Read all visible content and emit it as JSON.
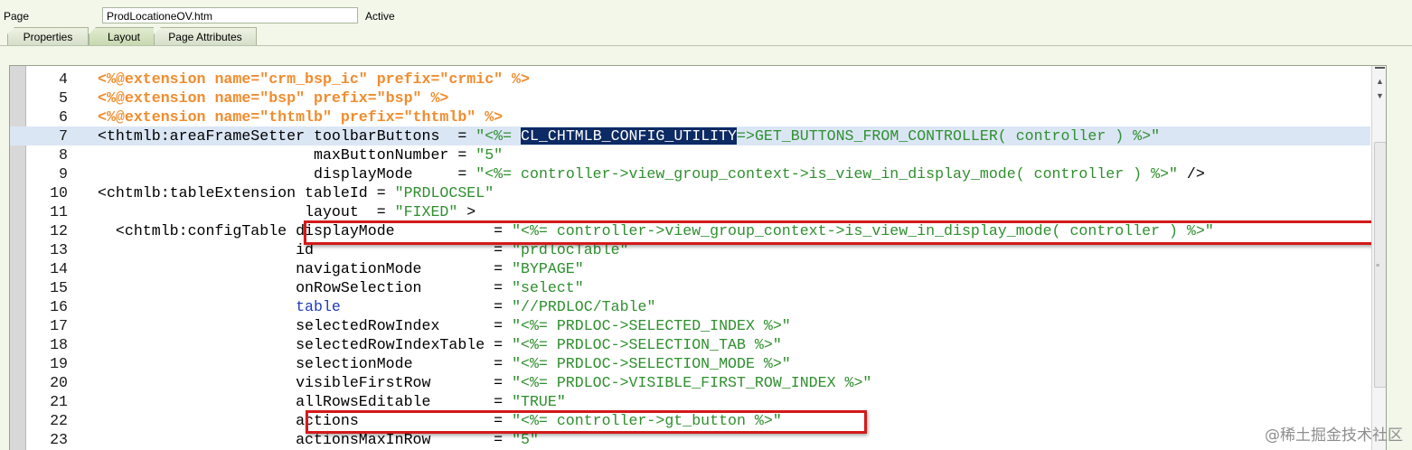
{
  "header": {
    "page_label": "Page",
    "page_value": "ProdLocationeOV.htm",
    "status": "Active"
  },
  "tabs": [
    {
      "label": "Properties",
      "active": false
    },
    {
      "label": "Layout",
      "active": true
    },
    {
      "label": "Page Attributes",
      "active": false
    }
  ],
  "editor": {
    "lines": [
      {
        "num": "4",
        "parts": [
          {
            "t": "<%@extension name=\"crm_bsp_ic\" prefix=\"crmic\" %>",
            "c": "dir"
          }
        ]
      },
      {
        "num": "5",
        "parts": [
          {
            "t": "<%@extension name=\"bsp\" prefix=\"bsp\" %>",
            "c": "dir"
          }
        ]
      },
      {
        "num": "6",
        "parts": [
          {
            "t": "<%@extension name=\"thtmlb\" prefix=\"thtmlb\" %>",
            "c": "dir"
          }
        ]
      },
      {
        "num": "7",
        "highlight": true,
        "parts": [
          {
            "t": "<thtmlb:areaFrameSetter toolbarButtons  = ",
            "c": ""
          },
          {
            "t": "\"<%= ",
            "c": "str"
          },
          {
            "t": "CL_CHTMLB_CONFIG_UTILITY",
            "c": "sel"
          },
          {
            "t": "=>GET_BUTTONS_FROM_CONTROLLER( controller ) %>\"",
            "c": "str"
          }
        ]
      },
      {
        "num": "8",
        "parts": [
          {
            "t": "                        maxButtonNumber = ",
            "c": ""
          },
          {
            "t": "\"5\"",
            "c": "str"
          }
        ]
      },
      {
        "num": "9",
        "parts": [
          {
            "t": "                        displayMode     = ",
            "c": ""
          },
          {
            "t": "\"<%= controller->view_group_context->is_view_in_display_mode( controller ) %>\"",
            "c": "str"
          },
          {
            "t": " />",
            "c": ""
          }
        ]
      },
      {
        "num": "10",
        "parts": [
          {
            "t": "<chtmlb:tableExtension tableId = ",
            "c": ""
          },
          {
            "t": "\"PRDLOCSEL\"",
            "c": "str"
          }
        ]
      },
      {
        "num": "11",
        "parts": [
          {
            "t": "                       layout  = ",
            "c": ""
          },
          {
            "t": "\"FIXED\"",
            "c": "str"
          },
          {
            "t": " >",
            "c": ""
          }
        ]
      },
      {
        "num": "12",
        "parts": [
          {
            "t": "  <chtmlb:configTable displayMode           = ",
            "c": ""
          },
          {
            "t": "\"<%= controller->view_group_context->is_view_in_display_mode( controller ) %>\"",
            "c": "str"
          }
        ]
      },
      {
        "num": "13",
        "parts": [
          {
            "t": "                      id                    = ",
            "c": ""
          },
          {
            "t": "\"prdlocTable\"",
            "c": "str"
          }
        ]
      },
      {
        "num": "14",
        "parts": [
          {
            "t": "                      navigationMode        = ",
            "c": ""
          },
          {
            "t": "\"BYPAGE\"",
            "c": "str"
          }
        ]
      },
      {
        "num": "15",
        "parts": [
          {
            "t": "                      onRowSelection        = ",
            "c": ""
          },
          {
            "t": "\"select\"",
            "c": "str"
          }
        ]
      },
      {
        "num": "16",
        "parts": [
          {
            "t": "                      ",
            "c": ""
          },
          {
            "t": "table",
            "c": "kw"
          },
          {
            "t": "                 = ",
            "c": ""
          },
          {
            "t": "\"//PRDLOC/Table\"",
            "c": "str"
          }
        ]
      },
      {
        "num": "17",
        "parts": [
          {
            "t": "                      selectedRowIndex      = ",
            "c": ""
          },
          {
            "t": "\"<%= PRDLOC->SELECTED_INDEX %>\"",
            "c": "str"
          }
        ]
      },
      {
        "num": "18",
        "parts": [
          {
            "t": "                      selectedRowIndexTable = ",
            "c": ""
          },
          {
            "t": "\"<%= PRDLOC->SELECTION_TAB %>\"",
            "c": "str"
          }
        ]
      },
      {
        "num": "19",
        "parts": [
          {
            "t": "                      selectionMode         = ",
            "c": ""
          },
          {
            "t": "\"<%= PRDLOC->SELECTION_MODE %>\"",
            "c": "str"
          }
        ]
      },
      {
        "num": "20",
        "parts": [
          {
            "t": "                      visibleFirstRow       = ",
            "c": ""
          },
          {
            "t": "\"<%= PRDLOC->VISIBLE_FIRST_ROW_INDEX %>\"",
            "c": "str"
          }
        ]
      },
      {
        "num": "21",
        "parts": [
          {
            "t": "                      allRowsEditable       = ",
            "c": ""
          },
          {
            "t": "\"TRUE\"",
            "c": "str"
          }
        ]
      },
      {
        "num": "22",
        "parts": [
          {
            "t": "                      actions               = ",
            "c": ""
          },
          {
            "t": "\"<%= controller->gt_button %>\"",
            "c": "str"
          }
        ]
      },
      {
        "num": "23",
        "parts": [
          {
            "t": "                      actionsMaxInRow       = ",
            "c": ""
          },
          {
            "t": "\"5\"",
            "c": "str"
          }
        ]
      }
    ]
  },
  "scrollbar": {
    "up_icon": "▲",
    "down_icon": "▼"
  },
  "watermark": "@稀土掘金技术社区"
}
